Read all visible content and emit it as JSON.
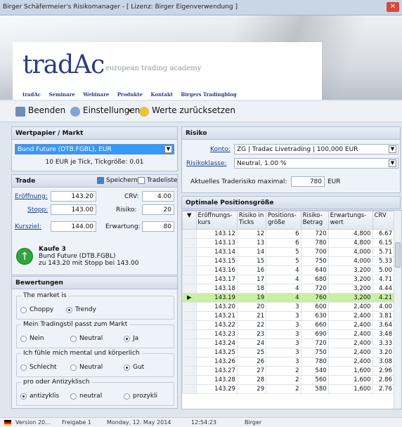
{
  "window": {
    "title": "Birger Schäfermeier's Risikomanager - [ Lizenz: Birger Eigenverwendung ]"
  },
  "banner": {
    "logo": "tradAc",
    "tagline": "european trading academy",
    "nav": [
      "tradAc",
      "Seminare",
      "Webinare",
      "Produkte",
      "Kontakt",
      "Birgers Tradingblog"
    ]
  },
  "toolbar": {
    "quit": "Beenden",
    "settings": "Einstellungen",
    "reset": "Werte zurücksetzen"
  },
  "security": {
    "header": "Wertpapier / Markt",
    "selected": "Bund Future (DTB.FGBL), EUR",
    "tickinfo": "10 EUR je Tick, Tickgröße: 0.01"
  },
  "trade": {
    "header": "Trade",
    "save": "Speichern",
    "tradelist": "Tradeliste",
    "entry_label": "Eröffnung:",
    "entry": "143.20",
    "stop_label": "Stopp:",
    "stop": "143.00",
    "target_label": "Kursziel:",
    "target": "144.00",
    "crv_label": "CRV:",
    "crv": "4.00",
    "risk_label": "Risiko:",
    "risk": "20",
    "exp_label": "Erwartung:",
    "exp": "80",
    "summary1": "Kaufe 3",
    "summary2": "Bund Future (DTB.FGBL)",
    "summary3": "zu 143.20 mit Stopp bei 143.00"
  },
  "ratings": {
    "header": "Bewertungen",
    "groups": [
      {
        "label": "The market is",
        "options": [
          "Choppy",
          "Trendy"
        ]
      },
      {
        "label": "Mein Tradingstil passt zum Markt",
        "options": [
          "Nein",
          "Neutral",
          "Ja"
        ]
      },
      {
        "label": "Ich fühle mich mental und körperlich",
        "options": [
          "Schlecht",
          "Neutral",
          "Gut"
        ]
      },
      {
        "label": "pro oder Antizyklisch",
        "options": [
          "antizyklis",
          "neutral",
          "prozykli"
        ]
      }
    ]
  },
  "risk": {
    "header": "Risiko",
    "account_label": "Konto:",
    "account": "ZG | Tradac Livetrading | 100,000 EUR",
    "class_label": "Risikoklasse:",
    "class": "Neutral, 1.00 %",
    "max_label": "Aktuelles Traderisiko maximal:",
    "max": "780",
    "currency": "EUR"
  },
  "positions": {
    "header": "Optimale Positionsgröße",
    "columns": [
      "Eröffnungs-kurs",
      "Risiko in Ticks",
      "Positions-größe",
      "Risiko-Betrag",
      "Erwartungs-wert",
      "CRV"
    ],
    "selected_row": 7,
    "rows": [
      [
        "143.12",
        "12",
        "6",
        "720",
        "4,800",
        "6.67"
      ],
      [
        "143.13",
        "13",
        "6",
        "780",
        "4,800",
        "6.15"
      ],
      [
        "143.14",
        "14",
        "5",
        "700",
        "4,000",
        "5.71"
      ],
      [
        "143.15",
        "15",
        "5",
        "750",
        "4,000",
        "5.33"
      ],
      [
        "143.16",
        "16",
        "4",
        "640",
        "3,200",
        "5.00"
      ],
      [
        "143.17",
        "17",
        "4",
        "680",
        "3,200",
        "4.71"
      ],
      [
        "143.18",
        "18",
        "4",
        "720",
        "3,200",
        "4.44"
      ],
      [
        "143.19",
        "19",
        "4",
        "760",
        "3,200",
        "4.21"
      ],
      [
        "143.20",
        "20",
        "3",
        "600",
        "2,400",
        "4.00"
      ],
      [
        "143.21",
        "21",
        "3",
        "630",
        "2,400",
        "3.81"
      ],
      [
        "143.22",
        "22",
        "3",
        "660",
        "2,400",
        "3.64"
      ],
      [
        "143.23",
        "23",
        "3",
        "690",
        "2,400",
        "3.48"
      ],
      [
        "143.24",
        "24",
        "3",
        "720",
        "2,400",
        "3.33"
      ],
      [
        "143.25",
        "25",
        "3",
        "750",
        "2,400",
        "3.20"
      ],
      [
        "143.26",
        "26",
        "3",
        "780",
        "2,400",
        "3.08"
      ],
      [
        "143.27",
        "27",
        "2",
        "540",
        "1,600",
        "2.96"
      ],
      [
        "143.28",
        "28",
        "2",
        "560",
        "1,600",
        "2.86"
      ],
      [
        "143.29",
        "29",
        "2",
        "580",
        "1,600",
        "2.76"
      ]
    ]
  },
  "status": {
    "version": "Version 20...",
    "release": "Freigabe 1",
    "date": "Monday, 12. May 2014",
    "time": "12:54:23",
    "user": "Birger"
  }
}
